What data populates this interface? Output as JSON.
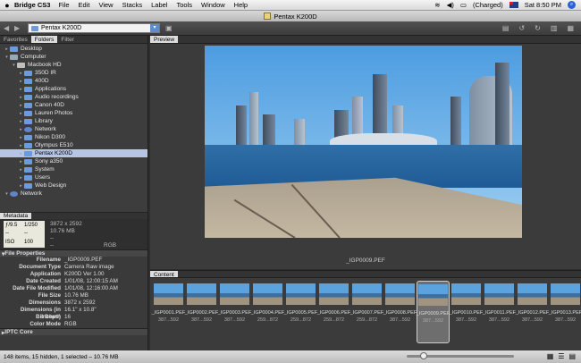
{
  "menubar": {
    "app_name": "Bridge CS3",
    "items": [
      "File",
      "Edit",
      "View",
      "Stacks",
      "Label",
      "Tools",
      "Window",
      "Help"
    ],
    "battery": "(Charged)",
    "clock": "Sat 8:50 PM"
  },
  "window": {
    "title": "Pentax K200D"
  },
  "toolbar": {
    "path": "Pentax K200D"
  },
  "left_tabs": [
    "Favorites",
    "Folders",
    "Filter"
  ],
  "tree": [
    {
      "label": "Desktop",
      "depth": 0,
      "icon": "folder",
      "selected": false
    },
    {
      "label": "Computer",
      "depth": 0,
      "icon": "computer",
      "selected": false
    },
    {
      "label": "Macbook HD",
      "depth": 1,
      "icon": "drive",
      "selected": false
    },
    {
      "label": "350D IR",
      "depth": 2,
      "icon": "folder",
      "selected": false
    },
    {
      "label": "400D",
      "depth": 2,
      "icon": "folder",
      "selected": false
    },
    {
      "label": "Applications",
      "depth": 2,
      "icon": "folder",
      "selected": false
    },
    {
      "label": "Audio recordings",
      "depth": 2,
      "icon": "folder",
      "selected": false
    },
    {
      "label": "Canon 40D",
      "depth": 2,
      "icon": "folder",
      "selected": false
    },
    {
      "label": "Lauren Photos",
      "depth": 2,
      "icon": "folder",
      "selected": false
    },
    {
      "label": "Library",
      "depth": 2,
      "icon": "folder",
      "selected": false
    },
    {
      "label": "Network",
      "depth": 2,
      "icon": "network",
      "selected": false
    },
    {
      "label": "Nikon D300",
      "depth": 2,
      "icon": "folder",
      "selected": false
    },
    {
      "label": "Olympus E510",
      "depth": 2,
      "icon": "folder",
      "selected": false
    },
    {
      "label": "Pentax K200D",
      "depth": 2,
      "icon": "folder",
      "selected": true
    },
    {
      "label": "Sony a350",
      "depth": 2,
      "icon": "folder",
      "selected": false
    },
    {
      "label": "System",
      "depth": 2,
      "icon": "folder",
      "selected": false
    },
    {
      "label": "Users",
      "depth": 2,
      "icon": "folder",
      "selected": false
    },
    {
      "label": "Web Design",
      "depth": 2,
      "icon": "folder",
      "selected": false
    },
    {
      "label": "Network",
      "depth": 0,
      "icon": "network",
      "selected": false
    }
  ],
  "metadata_tab": "Metadata",
  "camera": {
    "aperture": "ƒ/9.5",
    "shutter": "1/250",
    "cell3": "--",
    "cell4": "--",
    "iso_icon": "ISO",
    "iso": "100",
    "dimensions": "3872 x 2592",
    "filesize": "10.76 MB",
    "blank1": "--",
    "blank2": "--",
    "colormode": "RGB"
  },
  "file_properties": {
    "heading": "File Properties",
    "rows": [
      {
        "k": "Filename",
        "v": "_IGP0009.PEF"
      },
      {
        "k": "Document Type",
        "v": "Camera Raw image"
      },
      {
        "k": "Application",
        "v": "K200D Ver 1.00"
      },
      {
        "k": "Date Created",
        "v": "1/01/08, 12:00:15 AM"
      },
      {
        "k": "Date File Modified",
        "v": "1/01/08, 12:16:00 AM"
      },
      {
        "k": "File Size",
        "v": "10.76 MB"
      },
      {
        "k": "Dimensions",
        "v": "3872 x 2592"
      },
      {
        "k": "Dimensions (in inches)",
        "v": "16.1\" x 10.8\""
      },
      {
        "k": "Bit Depth",
        "v": "16"
      },
      {
        "k": "Color Mode",
        "v": "RGB"
      }
    ]
  },
  "iptc_heading": "IPTC Core",
  "preview": {
    "tab": "Preview",
    "caption": "_IGP0009.PEF"
  },
  "content": {
    "tab": "Content",
    "thumbs": [
      {
        "name": "_IGP0001.PEF",
        "dim": "387...592"
      },
      {
        "name": "_IGP0002.PEF",
        "dim": "387...592"
      },
      {
        "name": "_IGP0003.PEF",
        "dim": "387...592"
      },
      {
        "name": "_IGP0004.PEF",
        "dim": "259...872"
      },
      {
        "name": "_IGP0005.PEF",
        "dim": "259...872"
      },
      {
        "name": "_IGP0006.PEF",
        "dim": "259...872"
      },
      {
        "name": "_IGP0007.PEF",
        "dim": "259...872"
      },
      {
        "name": "_IGP0008.PEF",
        "dim": "387...592"
      },
      {
        "name": "_IGP0009.PEF",
        "dim": "387...592",
        "selected": true
      },
      {
        "name": "_IGP0010.PEF",
        "dim": "387...592"
      },
      {
        "name": "_IGP0011.PEF",
        "dim": "387...592"
      },
      {
        "name": "_IGP0012.PEF",
        "dim": "387...592"
      },
      {
        "name": "_IGP0013.PEF",
        "dim": "387...592"
      }
    ]
  },
  "status": {
    "text": "148 items, 15 hidden, 1 selected – 10.76 MB",
    "thumb_size": 0.13
  }
}
